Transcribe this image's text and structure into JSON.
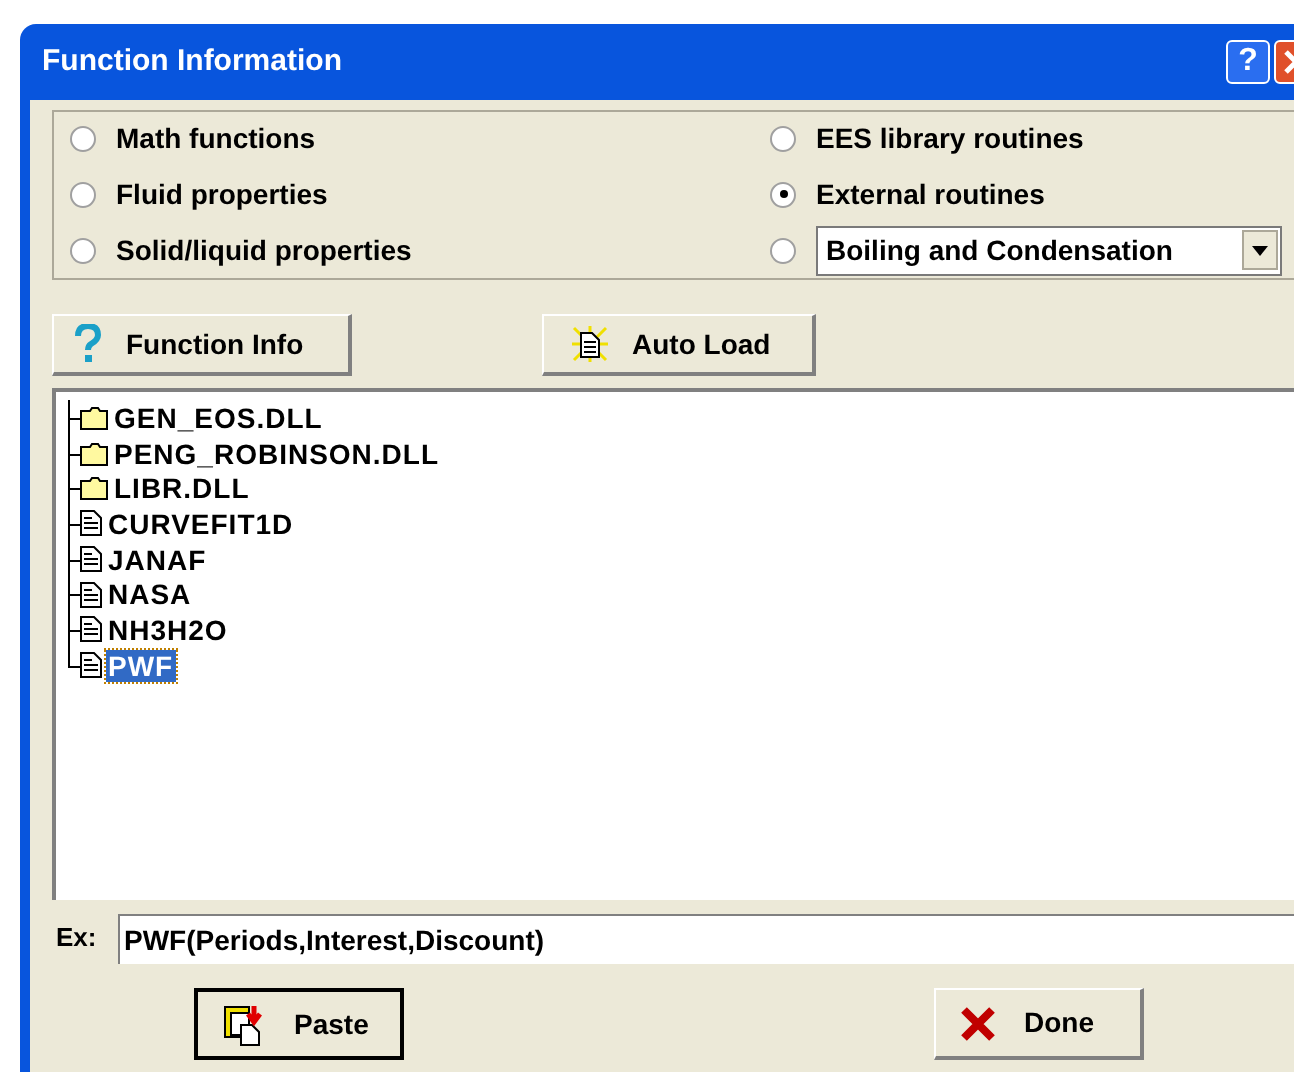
{
  "window": {
    "title": "Function Information",
    "help_button": "?"
  },
  "options": [
    {
      "kind": "radio",
      "label": "Math functions",
      "selected": false
    },
    {
      "kind": "radio",
      "label": "EES library routines",
      "selected": false
    },
    {
      "kind": "radio",
      "label": "Fluid properties",
      "selected": false
    },
    {
      "kind": "radio",
      "label": "External routines",
      "selected": true
    },
    {
      "kind": "radio",
      "label": "Solid/liquid properties",
      "selected": false
    },
    {
      "kind": "dropdown",
      "value": "Boiling and Condensation",
      "selected": false
    }
  ],
  "buttons": [
    {
      "kind": "info",
      "label": "Function Info"
    },
    {
      "kind": "autoload",
      "label": "Auto Load"
    }
  ],
  "tree": [
    {
      "kind": "folder",
      "label": "GEN_EOS.DLL",
      "selected": false
    },
    {
      "kind": "folder",
      "label": "PENG_ROBINSON.DLL",
      "selected": false
    },
    {
      "kind": "folder",
      "label": "LIBR.DLL",
      "selected": false
    },
    {
      "kind": "file",
      "label": "CURVEFIT1D",
      "selected": false
    },
    {
      "kind": "file",
      "label": "JANAF",
      "selected": false
    },
    {
      "kind": "file",
      "label": "NASA",
      "selected": false
    },
    {
      "kind": "file",
      "label": "NH3H2O",
      "selected": false
    },
    {
      "kind": "file",
      "label": "PWF",
      "selected": true
    }
  ],
  "example": {
    "label": "Ex:",
    "value": "PWF(Periods,Interest,Discount)"
  },
  "footer_buttons": [
    {
      "kind": "paste",
      "label": "Paste"
    },
    {
      "kind": "done",
      "label": "Done"
    }
  ]
}
